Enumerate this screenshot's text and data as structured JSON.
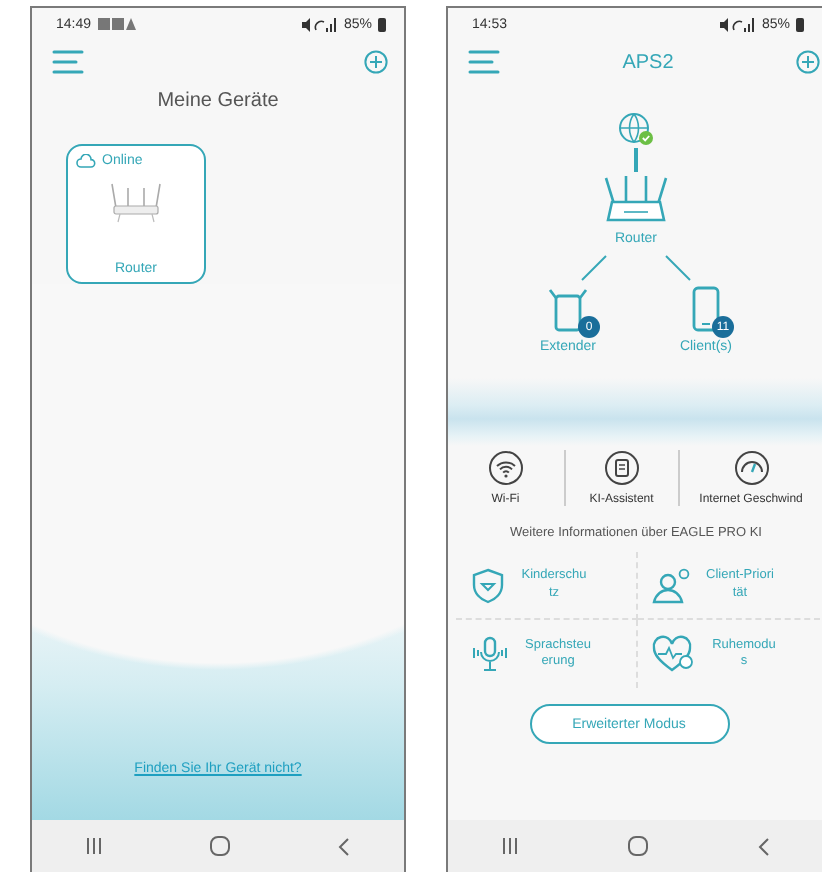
{
  "screens": [
    {
      "kind": "device_list",
      "status_bar": {
        "time": "14:49",
        "battery": "85%"
      },
      "title": "Meine Geräte",
      "devices": [
        {
          "status": "Online",
          "name": "Router"
        }
      ],
      "help_link": "Finden Sie Ihr Gerät nicht?"
    },
    {
      "kind": "network_map",
      "status_bar": {
        "time": "14:53",
        "battery": "85%"
      },
      "title": "APS2",
      "router": "Router",
      "nodes": [
        {
          "kind": "extender",
          "label": "Extender",
          "count": "0"
        },
        {
          "kind": "client",
          "label": "Client(s)",
          "count": "11"
        }
      ],
      "features": [
        {
          "kind": "wifi",
          "label": "Wi-Fi"
        },
        {
          "kind": "assistant",
          "label": "KI-Assistent"
        },
        {
          "kind": "speed",
          "label": "Internet Geschwind"
        }
      ],
      "info_link": "Weitere Informationen über EAGLE PRO KI",
      "tiles": [
        {
          "kind": "parental",
          "label": "Kinderschutz"
        },
        {
          "kind": "priority",
          "label": "Client-Priorität"
        },
        {
          "kind": "voice",
          "label": "Sprachsteuerung"
        },
        {
          "kind": "sleep",
          "label": "Ruhemodus"
        }
      ],
      "advanced_button": "Erweiterter Modus"
    }
  ]
}
